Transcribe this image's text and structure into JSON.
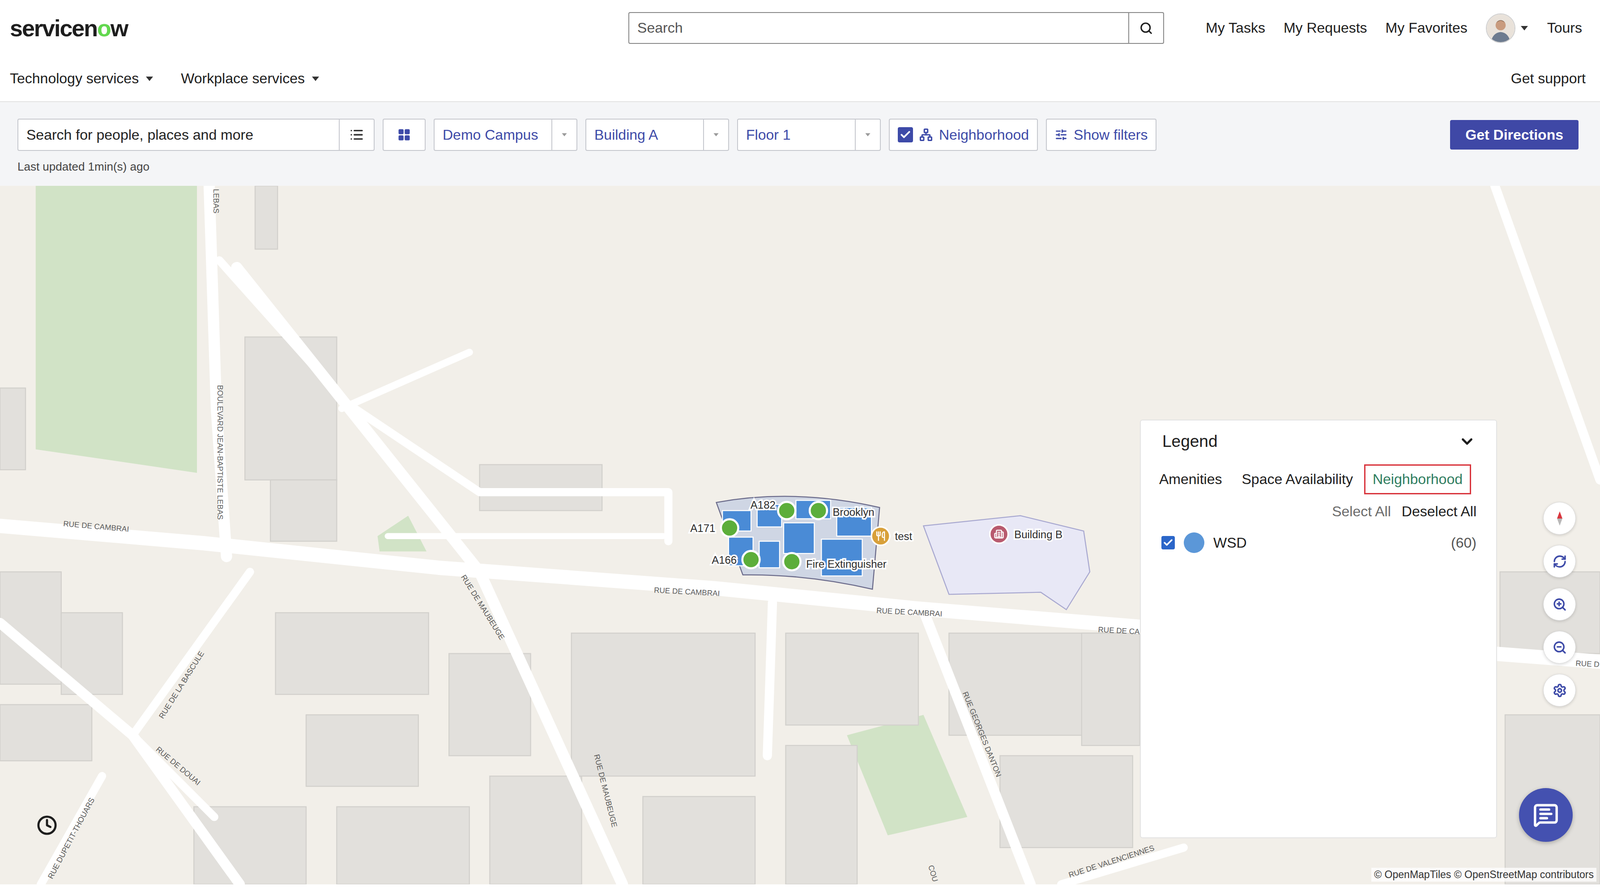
{
  "header": {
    "logo": [
      {
        "text": "servicen",
        "color": "#1d1d1d"
      },
      {
        "text": "o",
        "color": "#62d84e"
      },
      {
        "text": "w",
        "color": "#1d1d1d"
      }
    ],
    "search": {
      "placeholder": "Search"
    },
    "links": [
      "My Tasks",
      "My Requests",
      "My Favorites"
    ],
    "tours": "Tours"
  },
  "nav": {
    "menus": [
      {
        "label": "Technology services",
        "expanded": false
      },
      {
        "label": "Workplace services",
        "expanded": false
      }
    ],
    "support": "Get support"
  },
  "toolbar": {
    "search": {
      "placeholder": "Search for people, places and more"
    },
    "selects": [
      {
        "value": "Demo Campus"
      },
      {
        "value": "Building A"
      },
      {
        "value": "Floor 1"
      }
    ],
    "neighborhood": {
      "label": "Neighborhood",
      "checked": true
    },
    "filters": {
      "label": "Show filters"
    },
    "directions": {
      "label": "Get Directions"
    },
    "updated": "Last updated 1min(s) ago"
  },
  "map": {
    "streets": [
      "LEBAS",
      "BOULEVARD JEAN-BAPTISTE LEBAS",
      "RUE DE CAMBRAI",
      "RUE DE CAMBRAI",
      "RUE DE CAMBRAI",
      "RUE DE CA",
      "RUE DE MAUBEUGE",
      "RUE DE MAUBEUGE",
      "RUE DE LA BASCULE",
      "RUE DE DOUAI",
      "RUE DUPETIT-THOUARS",
      "RUE GEORGES DANTON",
      "RUE D",
      "COU",
      "RUE DE VALENCIENNES"
    ],
    "pins": [
      {
        "label": "A182",
        "kind": "space",
        "color": "#5cae3a"
      },
      {
        "label": "Brooklyn",
        "kind": "space",
        "color": "#5cae3a"
      },
      {
        "label": "A171",
        "kind": "space",
        "color": "#5cae3a"
      },
      {
        "label": "A166",
        "kind": "space",
        "color": "#5cae3a"
      },
      {
        "label": "Fire Extinguisher",
        "kind": "space",
        "color": "#5cae3a"
      },
      {
        "label": "test",
        "kind": "amenity",
        "color": "#d8a03a"
      },
      {
        "label": "Building B",
        "kind": "building",
        "color": "#b85a6e"
      }
    ],
    "attribution": "© OpenMapTiles © OpenStreetMap contributors"
  },
  "legend": {
    "title": "Legend",
    "expanded": true,
    "tabs": [
      {
        "label": "Amenities",
        "selected": false
      },
      {
        "label": "Space Availability",
        "selected": false
      },
      {
        "label": "Neighborhood",
        "selected": true
      }
    ],
    "select_all": "Select All",
    "deselect_all": "Deselect All",
    "items": [
      {
        "label": "WSD",
        "count": "(60)",
        "checked": true,
        "color": "#5b97d8"
      }
    ]
  }
}
